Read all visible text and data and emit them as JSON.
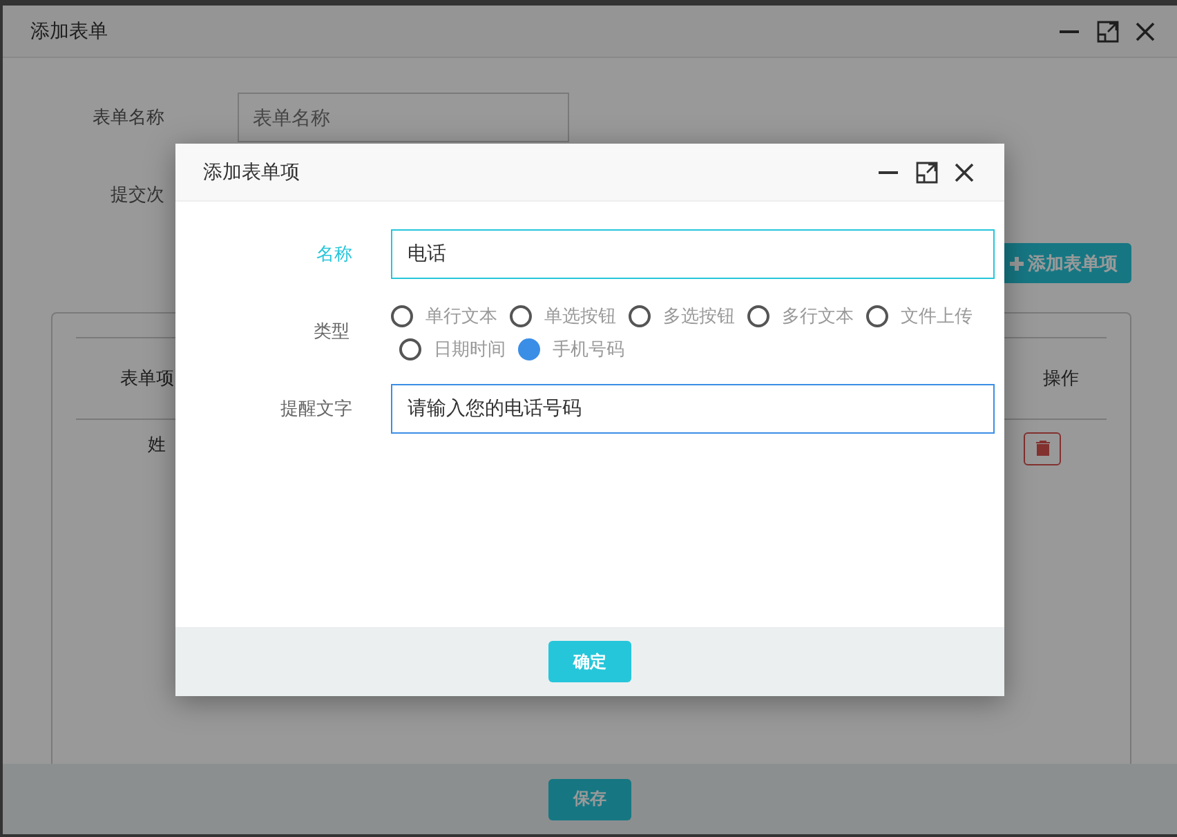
{
  "window": {
    "title": "添加表单"
  },
  "form": {
    "name_label": "表单名称",
    "name_field": {
      "placeholder": "表单名称"
    },
    "submit_label": "提交次",
    "add_item_button": "添加表单项"
  },
  "table": {
    "columns": [
      "表单项",
      "操作"
    ],
    "rows": [
      {
        "column_1": "姓"
      }
    ]
  },
  "save_button": "保存",
  "dialog": {
    "title": "添加表单项",
    "fields": [
      {
        "kind": "text",
        "label": "名称",
        "value": "电话",
        "active": true,
        "hovered": false
      },
      {
        "kind": "radio",
        "label": "类型",
        "options": [
          {
            "label": "单行文本",
            "selected": false
          },
          {
            "label": "单选按钮",
            "selected": false
          },
          {
            "label": "多选按钮",
            "selected": false
          },
          {
            "label": "多行文本",
            "selected": false
          },
          {
            "label": "文件上传",
            "selected": false
          },
          {
            "label": "日期时间",
            "selected": false
          },
          {
            "label": "手机号码",
            "selected": true
          }
        ]
      },
      {
        "kind": "text",
        "label": "提醒文字",
        "value": "请输入您的电话号码",
        "active": false,
        "hovered": true
      }
    ],
    "confirm_button": "确定"
  }
}
